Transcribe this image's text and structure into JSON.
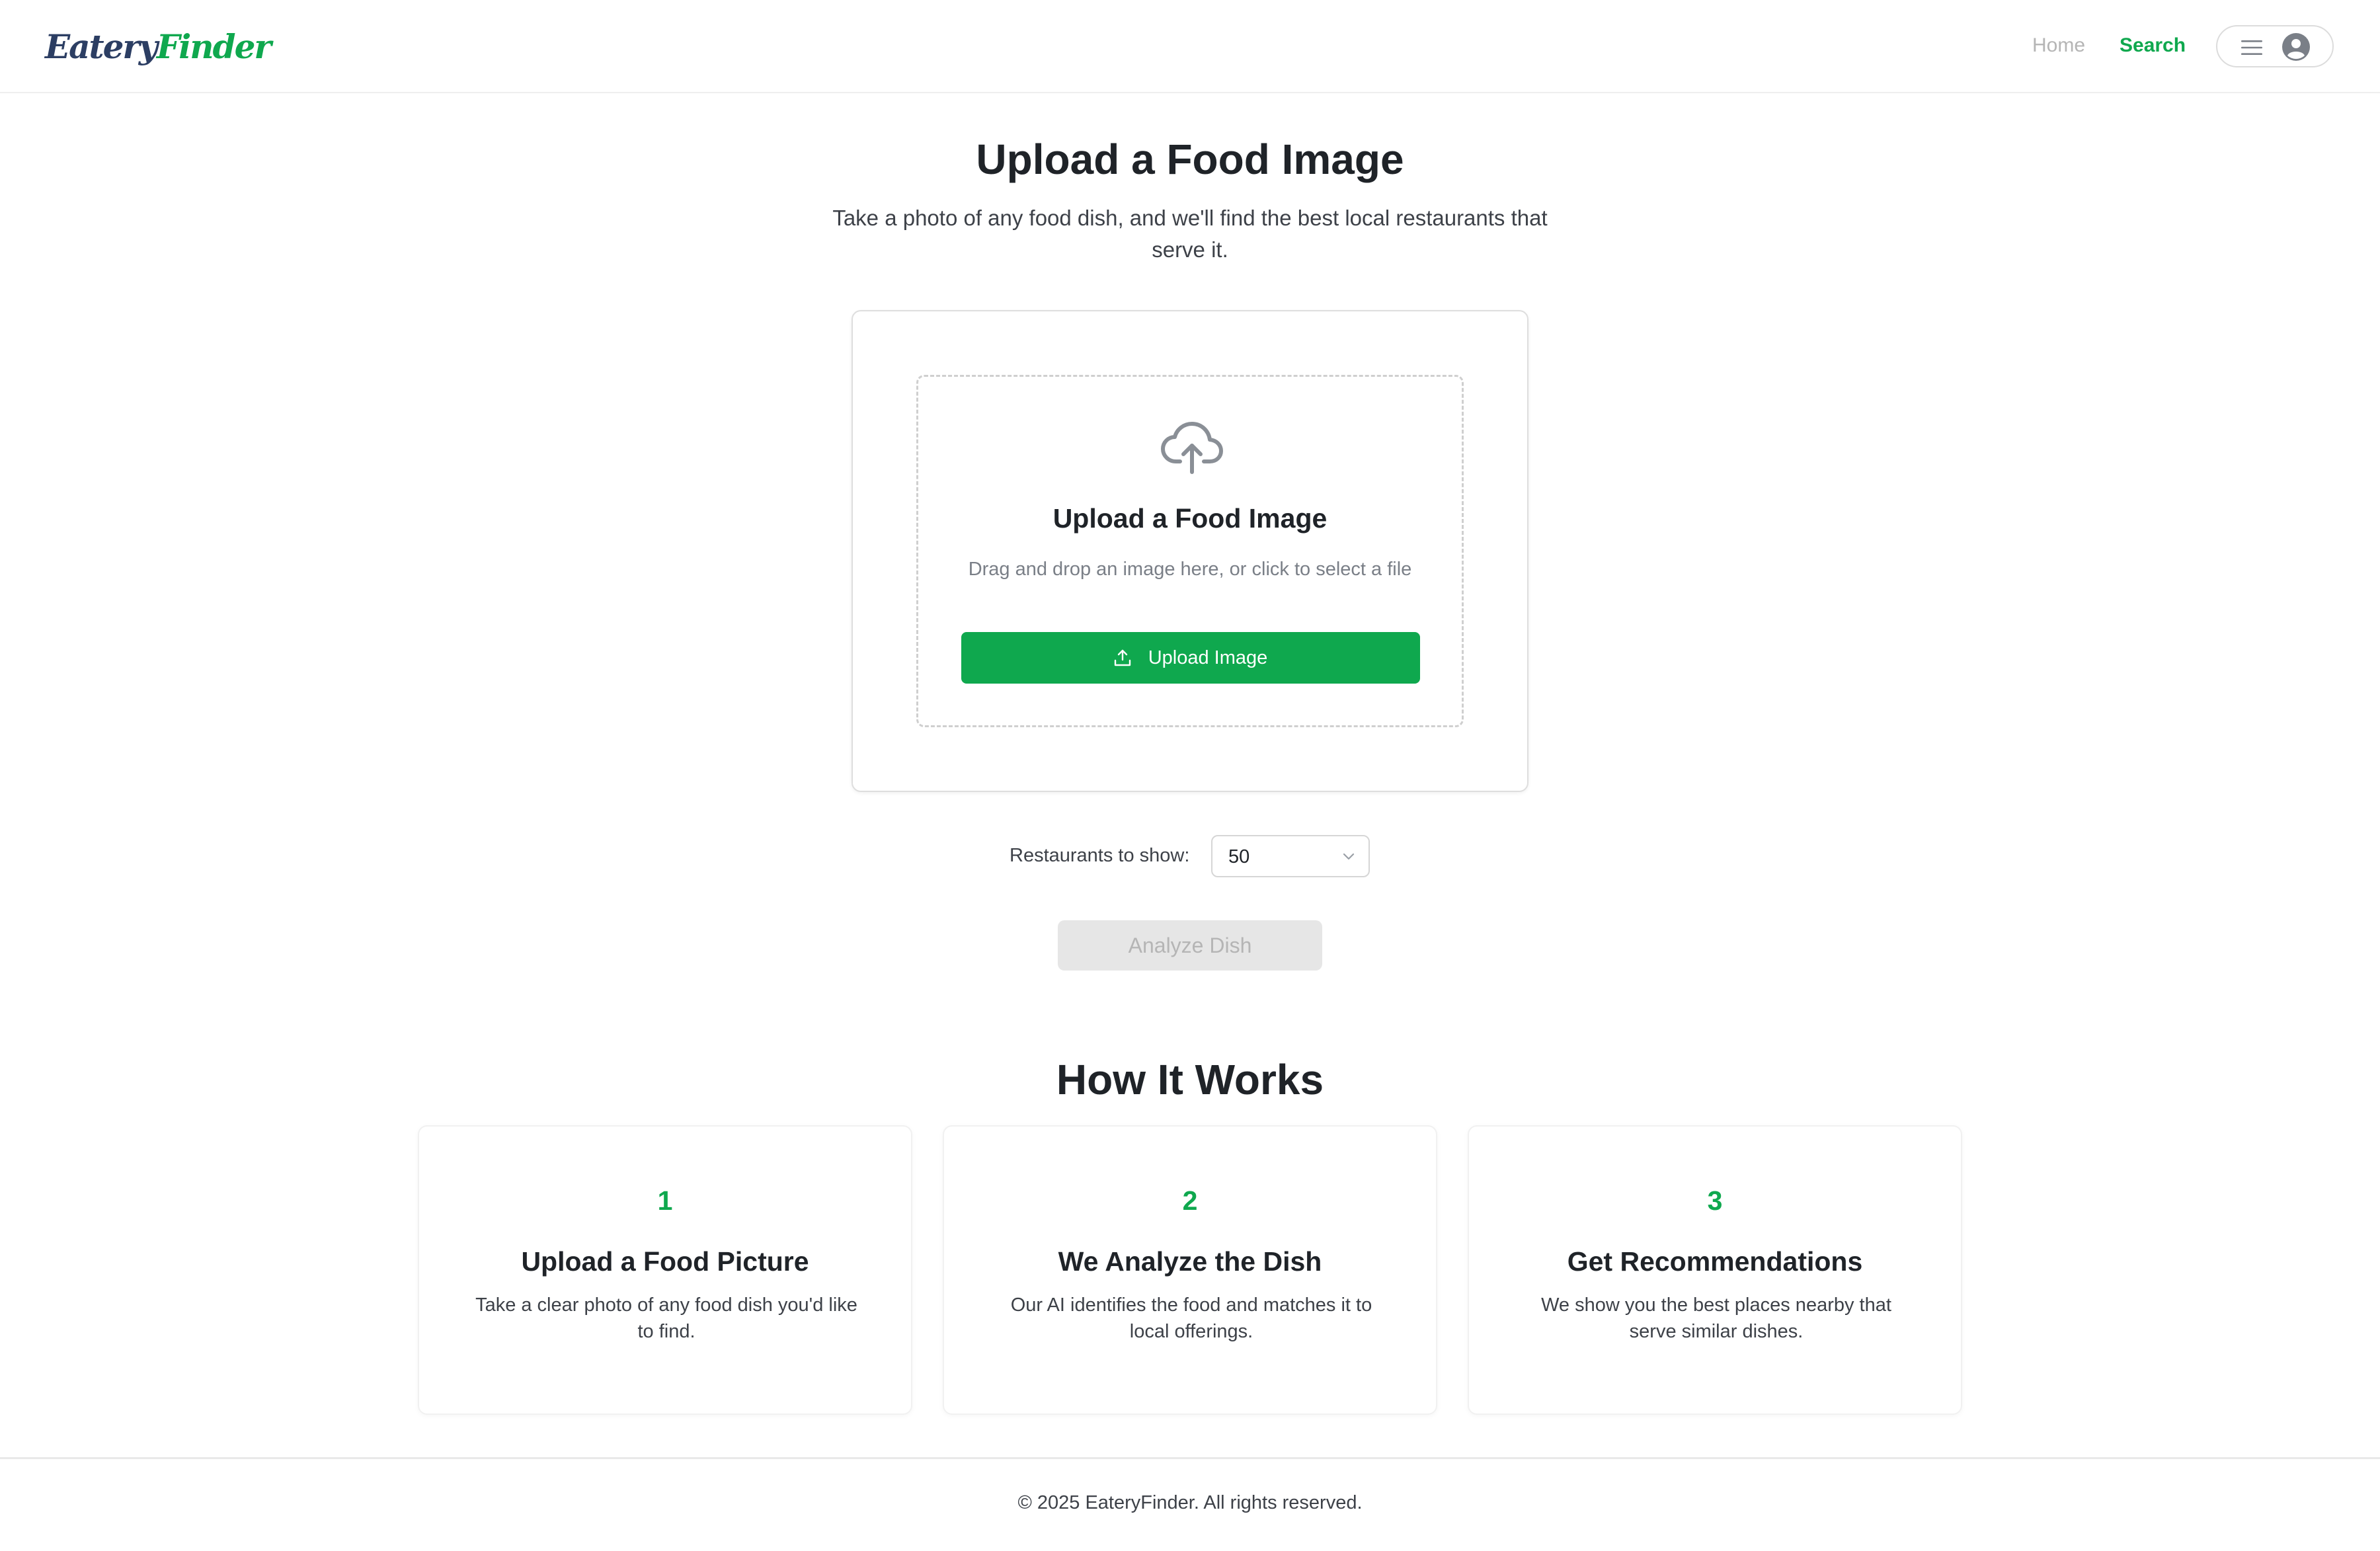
{
  "header": {
    "logo_part1": "Eatery",
    "logo_part2": "Finder",
    "nav": {
      "home": "Home",
      "search": "Search"
    },
    "user_menu_icons": [
      "menu-icon",
      "avatar-icon"
    ]
  },
  "hero": {
    "title": "Upload a Food Image",
    "subtitle": "Take a photo of any food dish, and we'll find the best local restaurants that serve it."
  },
  "upload": {
    "icon": "cloud-upload-icon",
    "title": "Upload a Food Image",
    "hint": "Drag and drop an image here, or click to select a file",
    "button_label": "Upload Image"
  },
  "count_select": {
    "label": "Restaurants to show:",
    "value": "50"
  },
  "analyze": {
    "label": "Analyze Dish",
    "disabled": true
  },
  "how_it_works": {
    "title": "How It Works",
    "steps": [
      {
        "num": "1",
        "title": "Upload a Food Picture",
        "desc": "Take a clear photo of any food dish you'd like to find."
      },
      {
        "num": "2",
        "title": "We Analyze the Dish",
        "desc": "Our AI identifies the food and matches it to local offerings."
      },
      {
        "num": "3",
        "title": "Get Recommendations",
        "desc": "We show you the best places nearby that serve similar dishes."
      }
    ]
  },
  "footer": {
    "copyright": "© 2025 EateryFinder. All rights reserved."
  },
  "colors": {
    "brand_green": "#0fa84e",
    "brand_navy": "#2c3e63",
    "disabled_bg": "#e6e6e6",
    "disabled_text": "#b5b5b5"
  }
}
